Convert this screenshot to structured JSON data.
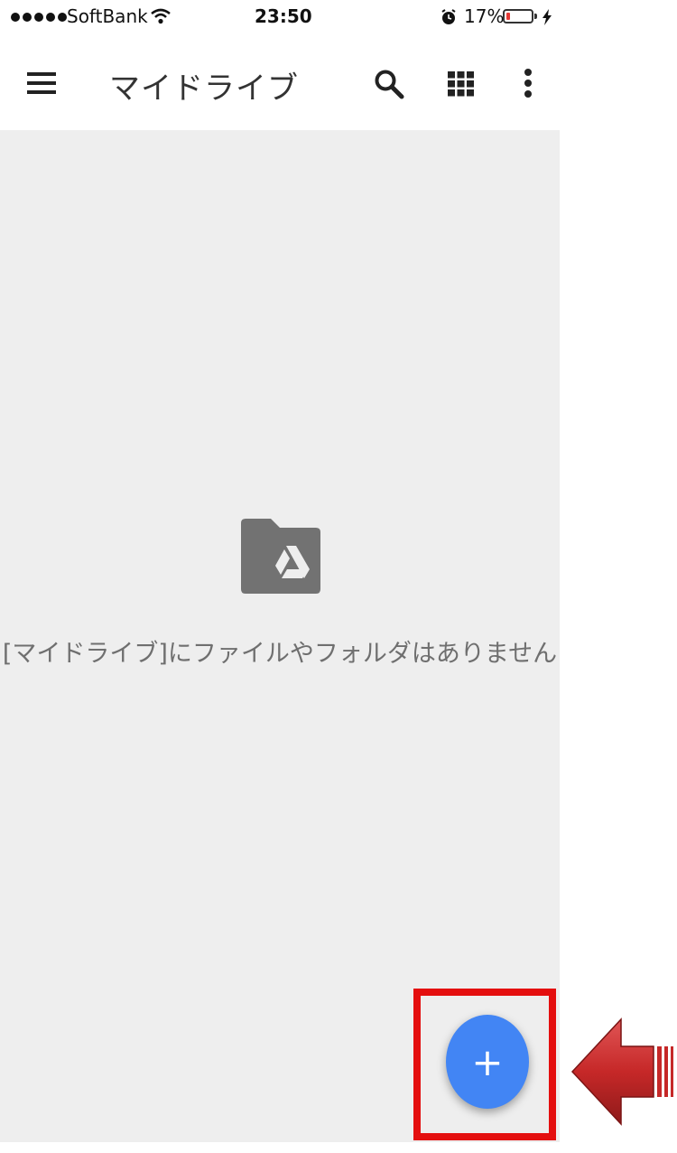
{
  "status_bar": {
    "carrier": "SoftBank",
    "time": "23:50",
    "battery_percent": "17%",
    "battery_level": 0.17,
    "icons": [
      "signal-dots-icon",
      "wifi-icon",
      "alarm-icon",
      "battery-icon",
      "charging-bolt-icon"
    ]
  },
  "app_bar": {
    "title": "マイドライブ",
    "icons": [
      "menu-icon",
      "search-icon",
      "grid-view-icon",
      "more-vert-icon"
    ]
  },
  "main": {
    "empty_icon": "drive-folder-icon",
    "empty_message": "[マイドライブ]にファイルやフォルダはありません"
  },
  "fab": {
    "label": "+",
    "icon": "plus-icon",
    "color": "#4285f4"
  },
  "annotation": {
    "highlight_color": "#e40f0f",
    "arrow_color": "#c62828"
  }
}
